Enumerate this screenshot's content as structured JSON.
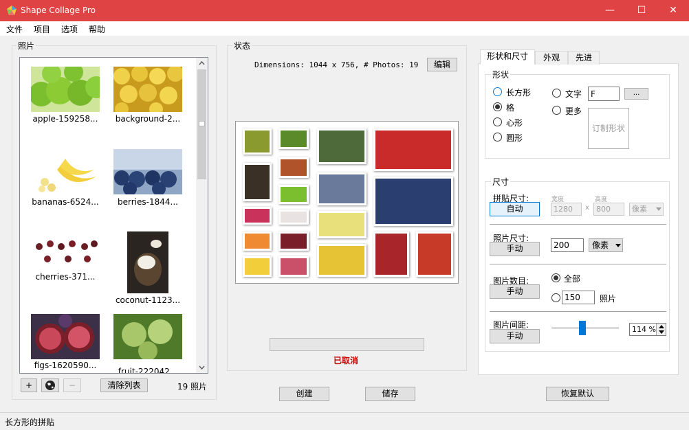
{
  "window": {
    "title": "Shape Collage Pro",
    "minimize": "—",
    "maximize": "☐",
    "close": "✕"
  },
  "menu": {
    "file": "文件",
    "project": "项目",
    "options": "选项",
    "help": "帮助"
  },
  "photos": {
    "group_label": "照片",
    "items": [
      {
        "caption": "apple-159258...",
        "color": "#7bbf2e"
      },
      {
        "caption": "background-2...",
        "color": "#e6c235"
      },
      {
        "caption": "bananas-6524...",
        "color": "#f0d04a"
      },
      {
        "caption": "berries-1844...",
        "color": "#2a3f70"
      },
      {
        "caption": "cherries-371...",
        "color": "#6a1e24"
      },
      {
        "caption": "coconut-1123...",
        "color": "#3b3026"
      },
      {
        "caption": "figs-1620590...",
        "color": "#7a1f2a"
      },
      {
        "caption": "fruit-222042...",
        "color": "#6b9a3a"
      }
    ],
    "add_button": "+",
    "remove_button": "−",
    "clear_button": "清除列表",
    "count": "19 照片"
  },
  "status": {
    "group_label": "状态",
    "dimensions": "Dimensions: 1044 x 756, # Photos: 19",
    "edit_button": "编辑",
    "cancelled_text": "已取消",
    "progress": 0
  },
  "actions": {
    "create": "创建",
    "save": "储存",
    "restore_defaults": "恢复默认"
  },
  "tabs": {
    "shape_size": "形状和尺寸",
    "appearance": "外观",
    "advanced": "先进"
  },
  "shape": {
    "group_label": "形状",
    "rectangle": "长方形",
    "grid": "格",
    "heart": "心形",
    "circle": "圆形",
    "text": "文字",
    "text_value": "F",
    "text_more_button": "...",
    "more": "更多",
    "custom_shape_button": "订制形状"
  },
  "size": {
    "group_label": "尺寸",
    "collage_size_label": "拼贴尺寸:",
    "collage_size_button": "自动",
    "width_label": "宽度",
    "height_label": "高度",
    "width_value": "1280",
    "height_value": "800",
    "x_sep": "x",
    "collage_unit": "像素",
    "photo_size_label": "照片尺寸:",
    "photo_size_button": "手动",
    "photo_size_value": "200",
    "photo_unit": "像素",
    "photo_count_label": "图片数目:",
    "photo_count_button": "手动",
    "count_all": "全部",
    "count_value": "150",
    "count_unit": "照片",
    "spacing_label": "图片间距:",
    "spacing_button": "手动",
    "spacing_value": "114 %"
  },
  "statusbar": {
    "text": "长方形的拼贴"
  }
}
